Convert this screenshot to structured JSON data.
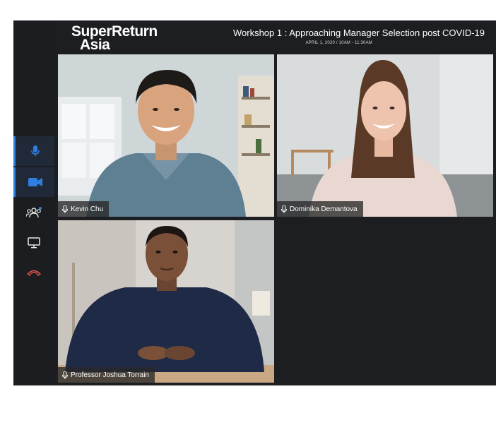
{
  "header": {
    "logo_line1": "SuperReturn",
    "logo_line2": "Asia",
    "title": "Workshop 1 : Approaching Manager Selection post COVID-19",
    "subtitle": "APRIL 1, 2020 / 10AM - 11:30AM"
  },
  "sidebar": {
    "items": [
      {
        "icon": "microphone-icon",
        "active": true
      },
      {
        "icon": "video-camera-icon",
        "active": true
      },
      {
        "icon": "participants-icon",
        "badge": true
      },
      {
        "icon": "screen-share-icon"
      },
      {
        "icon": "end-call-icon",
        "color": "#e0534f"
      }
    ]
  },
  "participants": [
    {
      "name": "Kevin Chu"
    },
    {
      "name": "Dominika Demantova"
    },
    {
      "name": "Professor Joshua Torrain"
    }
  ],
  "colors": {
    "background": "#1c1e21",
    "accent": "#2f7fe0",
    "end_call": "#e0534f"
  }
}
